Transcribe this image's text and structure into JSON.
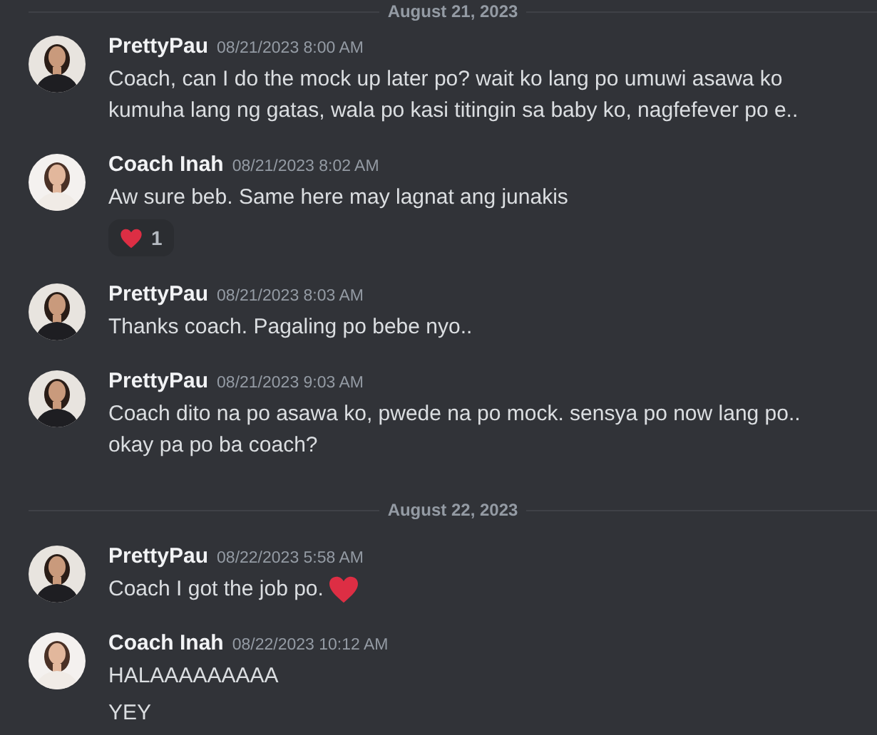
{
  "feed": [
    {
      "kind": "divider",
      "label": "August 21, 2023"
    },
    {
      "kind": "message",
      "author": "PrettyPau",
      "avatar": {
        "kind": "dark"
      },
      "timestamp": "08/21/2023 8:00 AM",
      "lines": [
        {
          "text": "Coach, can I do the mock up later po? wait ko lang po umuwi asawa ko kumuha lang ng gatas, wala po kasi titingin sa baby ko, nagfefever po e.."
        }
      ]
    },
    {
      "kind": "message",
      "author": "Coach Inah",
      "avatar": {
        "kind": "light"
      },
      "timestamp": "08/21/2023 8:02 AM",
      "lines": [
        {
          "text": "Aw sure beb. Same here may lagnat ang junakis"
        }
      ],
      "reaction": {
        "kind": "heart",
        "count": "1"
      }
    },
    {
      "kind": "message",
      "author": "PrettyPau",
      "avatar": {
        "kind": "dark"
      },
      "timestamp": "08/21/2023 8:03 AM",
      "lines": [
        {
          "text": "Thanks coach. Pagaling po bebe nyo.."
        }
      ]
    },
    {
      "kind": "message",
      "author": "PrettyPau",
      "avatar": {
        "kind": "dark"
      },
      "timestamp": "08/21/2023 9:03 AM",
      "lines": [
        {
          "text": "Coach dito na po asawa ko, pwede na po mock. sensya po now lang po.. okay pa po ba coach?"
        }
      ]
    },
    {
      "kind": "divider",
      "label": "August 22, 2023"
    },
    {
      "kind": "message",
      "author": "PrettyPau",
      "avatar": {
        "kind": "dark"
      },
      "timestamp": "08/22/2023 5:58 AM",
      "lines": [
        {
          "text": "Coach I got the job po.",
          "icon": {
            "kind": "heart"
          }
        }
      ]
    },
    {
      "kind": "message",
      "author": "Coach Inah",
      "avatar": {
        "kind": "light"
      },
      "timestamp": "08/22/2023 10:12 AM",
      "lines": [
        {
          "text": "HALAAAAAAAAA"
        },
        {
          "text": "YEY"
        }
      ]
    }
  ]
}
